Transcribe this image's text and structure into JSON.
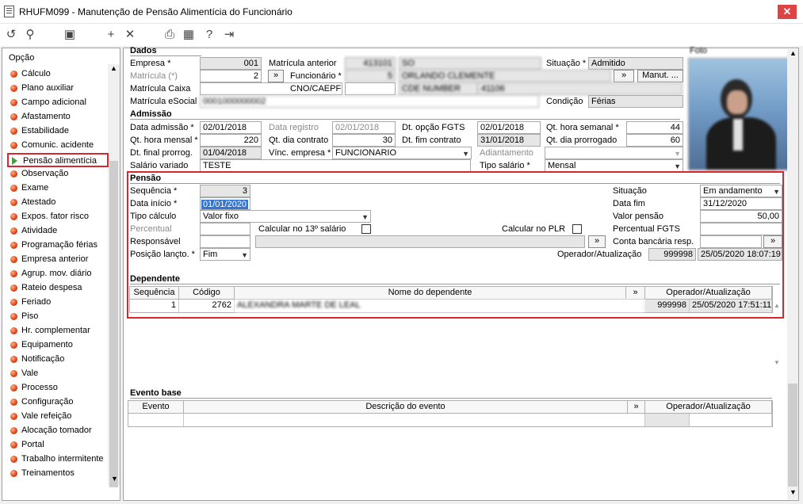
{
  "window": {
    "title": "RHUFM099 - Manutenção de Pensão Alimentícia do Funcionário",
    "close_icon": "close-icon"
  },
  "toolbar": {
    "icons": [
      "refresh-icon",
      "search-icon",
      "save-icon",
      "add-icon",
      "cancel-icon",
      "print-icon",
      "calendar-icon",
      "help-icon",
      "exit-icon"
    ]
  },
  "sidebar": {
    "header": "Opção",
    "items": [
      "Cálculo",
      "Plano auxiliar",
      "Campo adicional",
      "Afastamento",
      "Estabilidade",
      "Comunic. acidente",
      "Pensão alimentícia",
      "Observação",
      "Exame",
      "Atestado",
      "Expos. fator risco",
      "Atividade",
      "Programação férias",
      "Empresa anterior",
      "Agrup. mov. diário",
      "Rateio despesa",
      "Feriado",
      "Piso",
      "Hr. complementar",
      "Equipamento",
      "Notificação",
      "Vale",
      "Processo",
      "Configuração",
      "Vale refeição",
      "Alocação tomador",
      "Portal",
      "Trabalho intermitente",
      "Treinamentos"
    ],
    "selected": "Pensão alimentícia"
  },
  "dados": {
    "title": "Dados",
    "empresa_label": "Empresa *",
    "empresa": "001",
    "matricula_label": "Matrícula (*)",
    "matricula": "2",
    "matricula_caixa_label": "Matrícula Caixa",
    "matricula_caixa": "",
    "matricula_esocial_label": "Matrícula eSocial",
    "matricula_esocial": "0001000000002",
    "matricula_anterior_label": "Matrícula anterior",
    "matricula_anterior": "413101",
    "matricula_anterior_2": "SO",
    "funcionario_label": "Funcionário *",
    "funcionario_code": "5",
    "funcionario_name": "ORLANDO CLEMENTE",
    "cno_label": "CNO/CAEPF",
    "cno_1": "",
    "cno_2": "CDE NUMBER",
    "cno_3": "41106",
    "situacao_label": "Situação *",
    "situacao": "Admitido",
    "manut_label": "Manut. ...",
    "condicao_label": "Condição",
    "condicao": "Férias",
    "foto_label": "Foto"
  },
  "admissao": {
    "title": "Admissão",
    "data_admissao_label": "Data admissão *",
    "data_admissao": "02/01/2018",
    "data_registro_label": "Data registro",
    "data_registro": "02/01/2018",
    "dt_opcao_fgts_label": "Dt. opção FGTS",
    "dt_opcao_fgts": "02/01/2018",
    "qt_hora_semanal_label": "Qt. hora semanal *",
    "qt_hora_semanal": "44",
    "qt_hora_mensal_label": "Qt. hora mensal *",
    "qt_hora_mensal": "220",
    "qt_dia_contrato_label": "Qt. dia contrato",
    "qt_dia_contrato": "30",
    "dt_fim_contrato_label": "Dt. fim contrato",
    "dt_fim_contrato": "31/01/2018",
    "qt_dia_prorrogado_label": "Qt. dia prorrogado",
    "qt_dia_prorrogado": "60",
    "dt_final_prorrog_label": "Dt. final prorrog.",
    "dt_final_prorrog": "01/04/2018",
    "vinc_empresa_label": "Vínc. empresa *",
    "vinc_empresa": "FUNCIONARIO",
    "adiantamento_label": "Adiantamento",
    "adiantamento": "",
    "salario_variado_label": "Salário variado",
    "salario_variado": "TESTE",
    "tipo_salario_label": "Tipo salário *",
    "tipo_salario": "Mensal"
  },
  "pensao": {
    "title": "Pensão",
    "sequencia_label": "Sequência *",
    "sequencia": "3",
    "data_inicio_label": "Data início *",
    "data_inicio": "01/01/2020",
    "tipo_calculo_label": "Tipo cálculo",
    "tipo_calculo": "Valor fixo",
    "percentual_label": "Percentual",
    "percentual": "",
    "calc_13_label": "Calcular no 13º salário",
    "calc_plr_label": "Calcular no PLR",
    "responsavel_label": "Responsável",
    "responsavel": "",
    "posicao_label": "Posição lançto. *",
    "posicao": "Fim",
    "situacao_label": "Situação",
    "situacao": "Em andamento",
    "data_fim_label": "Data fim",
    "data_fim": "31/12/2020",
    "valor_pensao_label": "Valor pensão",
    "valor_pensao": "50,00",
    "percentual_fgts_label": "Percentual FGTS",
    "percentual_fgts": "",
    "conta_bancaria_label": "Conta bancária resp.",
    "conta_bancaria": "",
    "operador_label": "Operador/Atualização",
    "operador": "999998",
    "atualizacao": "25/05/2020 18:07:19",
    "lookup_btn": "»"
  },
  "dependente": {
    "title": "Dependente",
    "columns": [
      "Sequência",
      "Código",
      "Nome do dependente",
      "»",
      "Operador/Atualização"
    ],
    "rows": [
      {
        "sequencia": "1",
        "codigo": "2762",
        "nome": "ALEXANDRA MARTE DE LEAL",
        "operador": "999998",
        "atualizacao": "25/05/2020 17:51:11"
      }
    ]
  },
  "evento_base": {
    "title": "Evento base",
    "columns": [
      "Evento",
      "Descrição do evento",
      "»",
      "Operador/Atualização"
    ]
  }
}
